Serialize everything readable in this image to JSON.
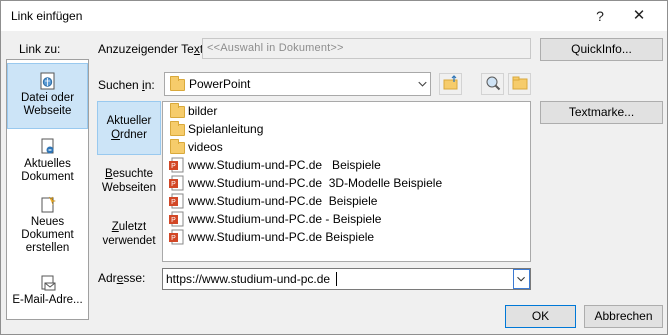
{
  "window": {
    "title": "Link einfügen",
    "help_glyph": "?",
    "close_glyph": "✕"
  },
  "link_to": {
    "label": "Link zu:",
    "items": [
      {
        "label": "Datei oder Webseite",
        "icon": "web-page-icon",
        "selected": true
      },
      {
        "label": "Aktuelles Dokument",
        "icon": "document-place-icon"
      },
      {
        "label": "Neues Dokument erstellen",
        "icon": "new-document-icon"
      },
      {
        "label": "E-Mail-Adre...",
        "icon": "email-icon"
      }
    ]
  },
  "display_text": {
    "label": "Anzuzeigender Text:",
    "placeholder": "<<Auswahl in Dokument>>"
  },
  "quickinfo_button": "QuickInfo...",
  "search_in": {
    "label": "Suchen in:",
    "value": "PowerPoint"
  },
  "toolbar": {
    "up_folder_icon": "folder-up-icon",
    "browse_web_icon": "browse-web-icon",
    "browse_file_icon": "browse-file-icon"
  },
  "bookmark_button": "Textmarke...",
  "side_tabs": [
    {
      "label": "Aktueller Ordner",
      "selected": true
    },
    {
      "label": "Besuchte Webseiten"
    },
    {
      "label": "Zuletzt verwendet"
    }
  ],
  "files": [
    {
      "name": "bilder",
      "type": "folder"
    },
    {
      "name": "Spielanleitung",
      "type": "folder"
    },
    {
      "name": "videos",
      "type": "folder"
    },
    {
      "name": "www.Studium-und-PC.de   Beispiele",
      "type": "ppt"
    },
    {
      "name": "www.Studium-und-PC.de  3D-Modelle Beispiele",
      "type": "ppt"
    },
    {
      "name": "www.Studium-und-PC.de  Beispiele",
      "type": "ppt"
    },
    {
      "name": "www.Studium-und-PC.de - Beispiele",
      "type": "ppt"
    },
    {
      "name": "www.Studium-und-PC.de Beispiele",
      "type": "ppt"
    }
  ],
  "address": {
    "label": "Adresse:",
    "value": "https://www.studium-und-pc.de"
  },
  "ok_button": "OK",
  "cancel_button": "Abbrechen",
  "colors": {
    "selection": "#cce4f7",
    "selection_border": "#99c9ef",
    "focus_border": "#3d7bd3"
  }
}
